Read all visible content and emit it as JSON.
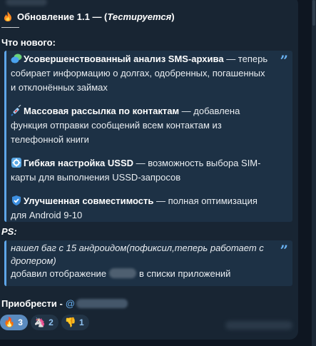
{
  "post": {
    "title_prefix": "Обновление 1.1 — (",
    "title_italic": "Тестируется",
    "title_suffix": ")",
    "divider": "——",
    "whats_new": "Что нового:",
    "features": [
      {
        "icon": "chat-bubble-icon",
        "bold": "Усовершенствованный анализ SMS-архива",
        "text_lines": [
          " — теперь",
          "собирает информацию о долгах, одобренных, погашенных",
          "и отклонённых займах"
        ]
      },
      {
        "icon": "syringe-icon",
        "bold": "Массовая рассылка по контактам",
        "text_lines": [
          " — добавлена",
          "функция отправки сообщений всем контактам из",
          "телефонной книги"
        ]
      },
      {
        "icon": "gear-icon",
        "bold": "Гибкая настройка USSD",
        "text_lines": [
          " — возможность выбора SIM-",
          "карты для выполнения USSD-запросов"
        ]
      },
      {
        "icon": "shield-icon",
        "bold": "Улучшенная совместимость",
        "text_lines": [
          " — полная оптимизация",
          "для Android 9-10"
        ]
      }
    ],
    "ps_label": "PS:",
    "ps_lines": [
      "нашел баг с 15 андроидом(пофиксил,теперь работает с",
      "дропером)"
    ],
    "ps_added_before": "добавил отображение",
    "ps_added_after": "в списки приложений",
    "buy_label": "Приобрести -",
    "buy_link_prefix": "@",
    "quote_mark": "”"
  },
  "reactions": [
    {
      "emoji": "🔥",
      "icon": "fire-icon",
      "count": "3",
      "active": true
    },
    {
      "emoji": "🦄",
      "icon": "unicorn-icon",
      "count": "2",
      "active": false
    },
    {
      "emoji": "👎",
      "icon": "thumbs-down-icon",
      "count": "1",
      "active": false
    }
  ],
  "colors": {
    "background": "#0e1621",
    "bubble": "#182533",
    "quote_bar": "#5ea5e8",
    "link": "#6ab2f2",
    "active_reaction": "#5b8bbf"
  }
}
